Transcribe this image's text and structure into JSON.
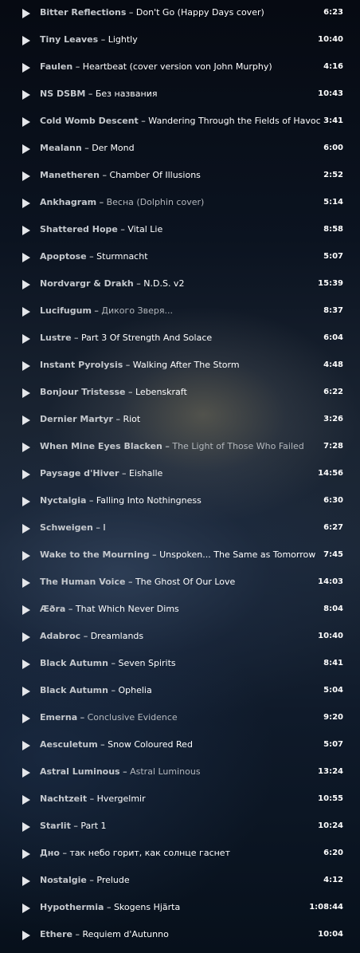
{
  "tracks": [
    {
      "artist": "Bitter Reflections",
      "separator": "–",
      "title": "Don't Go (Happy Days cover)",
      "duration": "6:23",
      "dim": false
    },
    {
      "artist": "Tiny Leaves",
      "separator": "–",
      "title": "Lightly",
      "duration": "10:40",
      "dim": false
    },
    {
      "artist": "Faulen",
      "separator": "–",
      "title": "Heartbeat (cover version von John Murphy)",
      "duration": "4:16",
      "dim": false
    },
    {
      "artist": "NS DSBM",
      "separator": "–",
      "title": "Без названия",
      "duration": "10:43",
      "dim": false
    },
    {
      "artist": "Cold Womb Descent",
      "separator": "–",
      "title": "Wandering Through the Fields of Havoc",
      "duration": "3:41",
      "dim": false
    },
    {
      "artist": "Mealann",
      "separator": "–",
      "title": "Der Mond",
      "duration": "6:00",
      "dim": false
    },
    {
      "artist": "Manetheren",
      "separator": "–",
      "title": "Chamber Of Illusions",
      "duration": "2:52",
      "dim": false
    },
    {
      "artist": "Ankhagram",
      "separator": "–",
      "title": "Весна (Dolphin cover)",
      "duration": "5:14",
      "dim": true
    },
    {
      "artist": "Shattered Hope",
      "separator": "–",
      "title": "Vital Lie",
      "duration": "8:58",
      "dim": false
    },
    {
      "artist": "Apoptose",
      "separator": "–",
      "title": "Sturmnacht",
      "duration": "5:07",
      "dim": false
    },
    {
      "artist": "Nordvargr & Drakh",
      "separator": "–",
      "title": "N.D.S. v2",
      "duration": "15:39",
      "dim": false
    },
    {
      "artist": "Lucifugum",
      "separator": "–",
      "title": "Дикого Зверя...",
      "duration": "8:37",
      "dim": true
    },
    {
      "artist": "Lustre",
      "separator": "–",
      "title": "Part 3 Of Strength And Solace",
      "duration": "6:04",
      "dim": false
    },
    {
      "artist": "Instant Pyrolysis",
      "separator": "–",
      "title": "Walking After The Storm",
      "duration": "4:48",
      "dim": false
    },
    {
      "artist": "Bonjour Tristesse",
      "separator": "–",
      "title": "Lebenskraft",
      "duration": "6:22",
      "dim": false
    },
    {
      "artist": "Dernier Martyr",
      "separator": "–",
      "title": "Riot",
      "duration": "3:26",
      "dim": false
    },
    {
      "artist": "When Mine Eyes Blacken",
      "separator": "–",
      "title": "The Light of Those Who Failed",
      "duration": "7:28",
      "dim": true
    },
    {
      "artist": "Paysage d'Hiver",
      "separator": "–",
      "title": "Eishalle",
      "duration": "14:56",
      "dim": false
    },
    {
      "artist": "Nyctalgia",
      "separator": "–",
      "title": "Falling Into Nothingness",
      "duration": "6:30",
      "dim": false
    },
    {
      "artist": "Schweigen",
      "separator": "–",
      "title": "I",
      "duration": "6:27",
      "dim": false
    },
    {
      "artist": "Wake to the Mourning",
      "separator": "–",
      "title": "Unspoken... The Same as Tomorrow",
      "duration": "7:45",
      "dim": false
    },
    {
      "artist": "The Human Voice",
      "separator": "–",
      "title": "The Ghost Of Our Love",
      "duration": "14:03",
      "dim": false
    },
    {
      "artist": "Æðra",
      "separator": "–",
      "title": "That Which Never Dims",
      "duration": "8:04",
      "dim": false
    },
    {
      "artist": "Adabroc",
      "separator": "–",
      "title": "Dreamlands",
      "duration": "10:40",
      "dim": false
    },
    {
      "artist": "Black Autumn",
      "separator": "–",
      "title": "Seven Spirits",
      "duration": "8:41",
      "dim": false
    },
    {
      "artist": "Black Autumn",
      "separator": "–",
      "title": "Ophelia",
      "duration": "5:04",
      "dim": false
    },
    {
      "artist": "Emerna",
      "separator": "–",
      "title": "Conclusive Evidence",
      "duration": "9:20",
      "dim": true
    },
    {
      "artist": "Aesculetum",
      "separator": "–",
      "title": "Snow Coloured Red",
      "duration": "5:07",
      "dim": false
    },
    {
      "artist": "Astral Luminous",
      "separator": "–",
      "title": "Astral Luminous",
      "duration": "13:24",
      "dim": true
    },
    {
      "artist": "Nachtzeit",
      "separator": "–",
      "title": "Hvergelmir",
      "duration": "10:55",
      "dim": false
    },
    {
      "artist": "Starlit",
      "separator": "–",
      "title": "Part 1",
      "duration": "10:24",
      "dim": false
    },
    {
      "artist": "Дно",
      "separator": "–",
      "title": "так небо горит, как солнце гаснет",
      "duration": "6:20",
      "dim": false
    },
    {
      "artist": "Nostalgie",
      "separator": "–",
      "title": "Prelude",
      "duration": "4:12",
      "dim": false
    },
    {
      "artist": "Hypothermia",
      "separator": "–",
      "title": "Skogens Hjärta",
      "duration": "1:08:44",
      "dim": false
    },
    {
      "artist": "Ethere",
      "separator": "–",
      "title": "Requiem d'Autunno",
      "duration": "10:04",
      "dim": false
    }
  ],
  "icons": {
    "play": "play-icon"
  },
  "colors": {
    "artist": "#c4c8cd",
    "title": "#ffffff",
    "title_dim": "#b4b8bd",
    "duration": "#ffffff",
    "play_icon": "#e4e6ea"
  }
}
